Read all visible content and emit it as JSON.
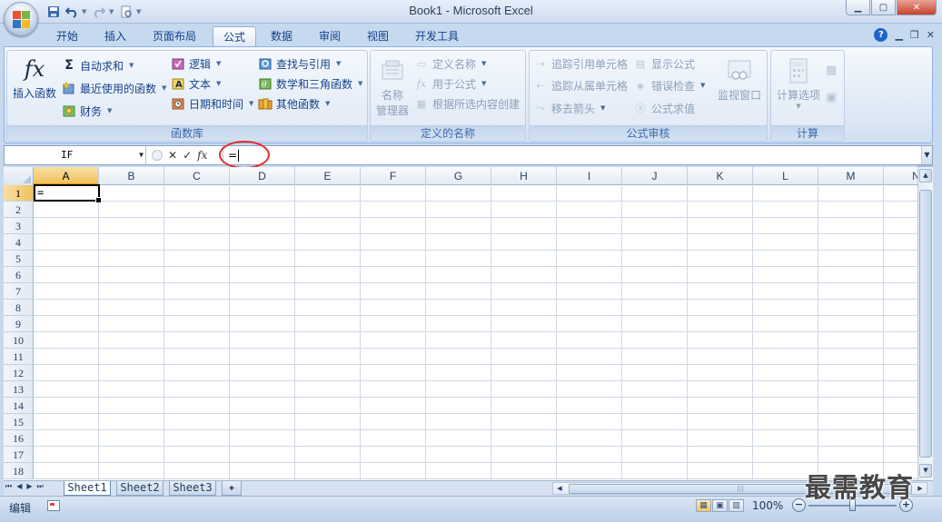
{
  "window": {
    "title": "Book1 - Microsoft Excel",
    "controls": {
      "minimize": "▁",
      "maximize": "▢",
      "close": "✕"
    }
  },
  "quick_access": [
    "save-icon",
    "undo-icon",
    "redo-icon",
    "print-preview-icon"
  ],
  "tabs": [
    {
      "label": "开始"
    },
    {
      "label": "插入"
    },
    {
      "label": "页面布局"
    },
    {
      "label": "公式",
      "active": true
    },
    {
      "label": "数据"
    },
    {
      "label": "审阅"
    },
    {
      "label": "视图"
    },
    {
      "label": "开发工具"
    }
  ],
  "ribbon": {
    "function_library": {
      "label": "函数库",
      "insert_function": "插入函数",
      "autosum": "自动求和",
      "recent": "最近使用的函数",
      "financial": "财务",
      "logical": "逻辑",
      "text": "文本",
      "datetime": "日期和时间",
      "lookup": "查找与引用",
      "math": "数学和三角函数",
      "more": "其他函数"
    },
    "defined_names": {
      "label": "定义的名称",
      "name_manager_line1": "名称",
      "name_manager_line2": "管理器",
      "define_name": "定义名称",
      "use_in_formula": "用于公式",
      "create_from_selection": "根据所选内容创建"
    },
    "formula_auditing": {
      "label": "公式审核",
      "trace_precedents": "追踪引用单元格",
      "trace_dependents": "追踪从属单元格",
      "remove_arrows": "移去箭头",
      "show_formulas": "显示公式",
      "error_checking": "错误检查",
      "evaluate_formula": "公式求值",
      "watch_window": "监视窗口"
    },
    "calculation": {
      "label": "计算",
      "options": "计算选项"
    }
  },
  "formula_bar": {
    "name_box": "IF",
    "content": "=",
    "fx": "fx",
    "cancel": "✕",
    "enter": "✓"
  },
  "grid": {
    "columns": [
      "A",
      "B",
      "C",
      "D",
      "E",
      "F",
      "G",
      "H",
      "I",
      "J",
      "K",
      "L",
      "M",
      "N"
    ],
    "rows": [
      "1",
      "2",
      "3",
      "4",
      "5",
      "6",
      "7",
      "8",
      "9",
      "10",
      "11",
      "12",
      "13",
      "14",
      "15",
      "16",
      "17",
      "18"
    ],
    "active_cell": {
      "ref": "A1",
      "value": "="
    }
  },
  "sheets": [
    {
      "label": "Sheet1",
      "active": true
    },
    {
      "label": "Sheet2"
    },
    {
      "label": "Sheet3"
    }
  ],
  "status": {
    "mode": "编辑",
    "zoom": "100%"
  },
  "watermark": "最需教育",
  "colors": {
    "accent_circle": "#e0302a",
    "active_header": "#f0c25e",
    "ribbon_text": "#15428b"
  }
}
